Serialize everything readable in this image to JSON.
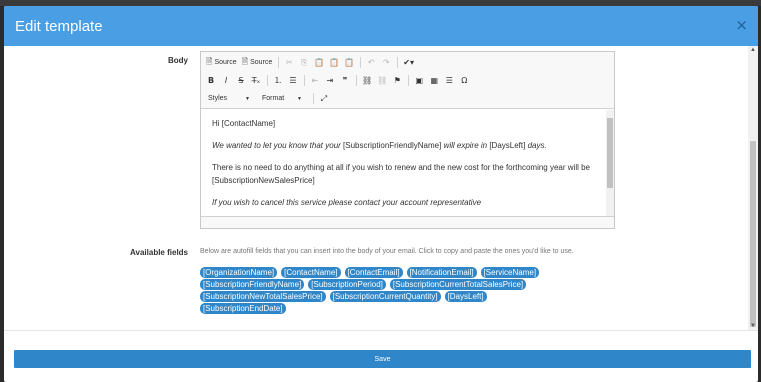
{
  "modal": {
    "title": "Edit template",
    "close_glyph": "×"
  },
  "body_label": "Body",
  "toolbar": {
    "row1": [
      {
        "icon": "source-icon",
        "glyph": "🗎",
        "label": "Source"
      },
      {
        "icon": "source-icon",
        "glyph": "🗎",
        "label": "Source"
      }
    ],
    "styles_label": "Styles",
    "format_label": "Format"
  },
  "content": {
    "line1": "Hi  [ContactName]",
    "line2_a": "We wanted to let you know that your ",
    "line2_b": "[SubscriptionFriendlyName]",
    "line2_c": " will expire in ",
    "line2_d": "[DaysLeft]",
    "line2_e": " days.",
    "line3": "There is no need to do anything at all if you wish to renew and the new cost for the forthcoming year will be [SubscriptionNewSalesPrice]",
    "line4": "If you wish to cancel this service please contact your account representative"
  },
  "available_fields": {
    "label": "Available fields",
    "description": "Below are autofill fields that you can insert into the body of your email. Click to copy and paste the ones you'd like to use.",
    "tags": [
      "[OrganizationName]",
      "[ContactName]",
      "[ContactEmail]",
      "[NotificationEmail]",
      "[ServiceName]",
      "[SubscriptionFriendlyName]",
      "[SubscriptionPeriod]",
      "[SubscriptionCurrentTotalSalesPrice]",
      "[SubscriptionNewTotalSalesPrice]",
      "[SubscriptionCurrentQuantity]",
      "[DaysLeft]",
      "[SubscriptionEndDate]"
    ]
  },
  "save_label": "Save",
  "colors": {
    "header": "#4a9ee3",
    "tag": "#2f86c8",
    "save": "#2f86c8"
  }
}
